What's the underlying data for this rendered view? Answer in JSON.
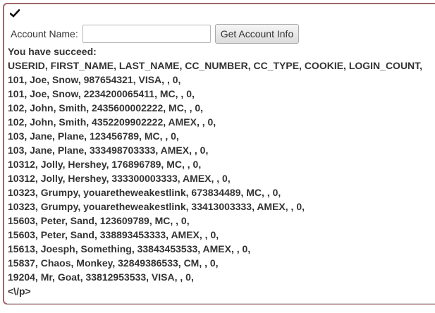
{
  "form": {
    "label": "Account Name:",
    "input_value": "",
    "input_placeholder": "",
    "button_label": "Get Account Info"
  },
  "icons": {
    "status": "checkmark-icon"
  },
  "result": {
    "status_text": "You have succeed:",
    "header": "USERID, FIRST_NAME, LAST_NAME, CC_NUMBER, CC_TYPE, COOKIE, LOGIN_COUNT,",
    "rows": [
      "101, Joe, Snow, 987654321, VISA, , 0,",
      "101, Joe, Snow, 2234200065411, MC, , 0,",
      "102, John, Smith, 2435600002222, MC, , 0,",
      "102, John, Smith, 4352209902222, AMEX, , 0,",
      "103, Jane, Plane, 123456789, MC, , 0,",
      "103, Jane, Plane, 333498703333, AMEX, , 0,",
      "10312, Jolly, Hershey, 176896789, MC, , 0,",
      "10312, Jolly, Hershey, 333300003333, AMEX, , 0,",
      "10323, Grumpy, youaretheweakestlink, 673834489, MC, , 0,",
      "10323, Grumpy, youaretheweakestlink, 33413003333, AMEX, , 0,",
      "15603, Peter, Sand, 123609789, MC, , 0,",
      "15603, Peter, Sand, 338893453333, AMEX, , 0,",
      "15613, Joesph, Something, 33843453533, AMEX, , 0,",
      "15837, Chaos, Monkey, 32849386533, CM, , 0,",
      "19204, Mr, Goat, 33812953533, VISA, , 0,"
    ],
    "trailer": "<\\/p>"
  },
  "colors": {
    "border": "#a06868",
    "text": "#333333"
  }
}
